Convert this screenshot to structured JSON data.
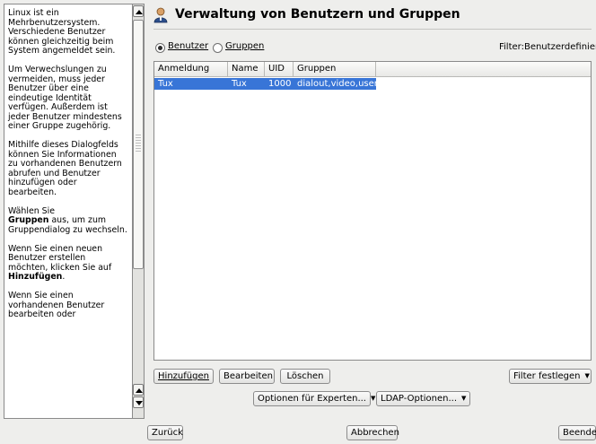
{
  "help": {
    "paragraphs": [
      "Linux ist ein Mehrbenutzersystem. Verschiedene Benutzer können gleichzeitig beim System angemeldet sein.",
      "Um Verwechslungen zu vermeiden, muss jeder Benutzer über eine eindeutige Identität verfügen. Außerdem ist jeder Benutzer mindestens einer Gruppe zugehörig.",
      "Mithilfe dieses Dialogfelds können Sie Informationen zu vorhandenen Benutzern abrufen und Benutzer hinzufügen oder bearbeiten.",
      "Wählen Sie",
      "aus, um zum Gruppendialog zu wechseln.",
      "Wenn Sie einen neuen Benutzer erstellen möchten, klicken Sie auf",
      "Wenn Sie einen vorhandenen Benutzer bearbeiten oder"
    ],
    "bold_groups": "Gruppen",
    "bold_add": "Hinzufügen",
    "period": "."
  },
  "header": {
    "title": "Verwaltung von Benutzern und Gruppen",
    "icon": "users-icon"
  },
  "view": {
    "users_label": "Benutzer",
    "groups_label": "Gruppen",
    "selected": "users",
    "filter_status": "Filter:Benutzerdefiniert"
  },
  "table": {
    "columns": [
      "Anmeldung",
      "Name",
      "UID",
      "Gruppen"
    ],
    "rows": [
      {
        "login": "Tux",
        "name": "Tux",
        "uid": "1000",
        "groups": "dialout,video,users"
      }
    ]
  },
  "actions": {
    "add": "Hinzufügen",
    "edit": "Bearbeiten",
    "delete": "Löschen",
    "set_filter": "Filter festlegen",
    "expert_options": "Optionen für Experten...",
    "ldap_options": "LDAP-Optionen..."
  },
  "nav": {
    "back": "Zurück",
    "cancel": "Abbrechen",
    "finish": "Beenden"
  },
  "colors": {
    "selection": "#3875d7",
    "background": "#eeeeec"
  }
}
